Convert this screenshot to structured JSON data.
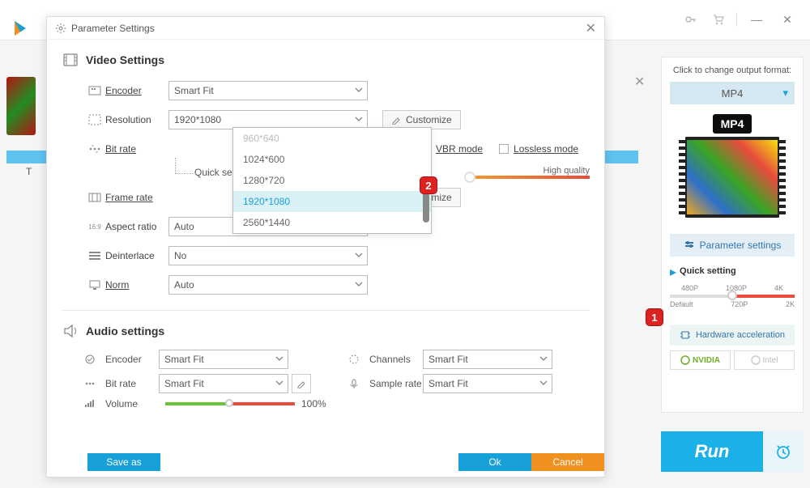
{
  "dialog": {
    "title": "Parameter Settings",
    "video_section": "Video Settings",
    "audio_section": "Audio settings",
    "labels": {
      "encoder": "Encoder",
      "resolution": "Resolution",
      "bitrate": "Bit rate",
      "quick_setting": "Quick setting",
      "framerate": "Frame rate",
      "aspect": "Aspect ratio",
      "deinterlace": "Deinterlace",
      "norm": "Norm",
      "channels": "Channels",
      "samplerate": "Sample rate",
      "volume": "Volume"
    },
    "values": {
      "encoder": "Smart Fit",
      "resolution": "1920*1080",
      "aspect": "Auto",
      "deinterlace": "No",
      "norm": "Auto",
      "a_encoder": "Smart Fit",
      "a_bitrate": "Smart Fit",
      "a_channels": "Smart Fit",
      "a_samplerate": "Smart Fit",
      "volume_pct": "100%"
    },
    "customize": "Customize",
    "customize_short": "ze",
    "vbr": "VBR mode",
    "lossless": "Lossless mode",
    "high_quality": "High quality",
    "resolution_options": [
      "960*640",
      "1024*600",
      "1280*720",
      "1920*1080",
      "2560*1440"
    ],
    "footer": {
      "saveas": "Save as",
      "ok": "Ok",
      "cancel": "Cancel"
    }
  },
  "right": {
    "title": "Click to change output format:",
    "format": "MP4",
    "param_settings": "Parameter settings",
    "quick_setting": "Quick setting",
    "ticks_top": [
      "480P",
      "1080P",
      "4K"
    ],
    "ticks_bot": [
      "Default",
      "720P",
      "2K"
    ],
    "hw_accel": "Hardware acceleration",
    "nvidia": "NVIDIA",
    "intel": "Intel"
  },
  "run": "Run",
  "thumb_label": "T",
  "markers": {
    "m1": "1",
    "m2": "2"
  }
}
